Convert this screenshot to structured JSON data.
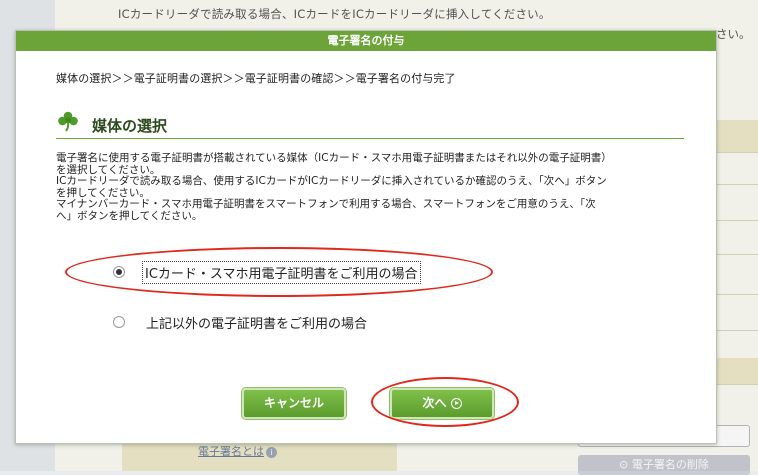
{
  "background": {
    "top_note": "ICカードリーダで読み取る場合、ICカードをICカードリーダに挿入してください。",
    "edge_text": "さい。",
    "signature_link": "電子署名とは",
    "info_icon": "i",
    "delete_button": "電子署名の削除"
  },
  "modal": {
    "title": "電子署名の付与",
    "breadcrumb": "媒体の選択＞＞電子証明書の選択＞＞電子証明書の確認＞＞電子署名の付与完了",
    "section_title": "媒体の選択",
    "instructions": [
      "電子署名に使用する電子証明書が搭載されている媒体（ICカード・スマホ用電子証明書またはそれ以外の電子証明書）",
      "を選択してください。",
      "ICカードリーダで読み取る場合、使用するICカードがICカードリーダに挿入されているか確認のうえ、「次へ」ボタン",
      "を押してください。",
      "マイナンバーカード・スマホ用電子証明書をスマートフォンで利用する場合、スマートフォンをご用意のうえ、「次",
      "へ」ボタンを押してください。"
    ],
    "options": [
      {
        "label": "ICカード・スマホ用電子証明書をご利用の場合",
        "selected": true
      },
      {
        "label": "上記以外の電子証明書をご利用の場合",
        "selected": false
      }
    ],
    "cancel_label": "キャンセル",
    "next_label": "次へ"
  },
  "colors": {
    "accent": "#6da43a",
    "highlight_ring": "#e0281b"
  }
}
